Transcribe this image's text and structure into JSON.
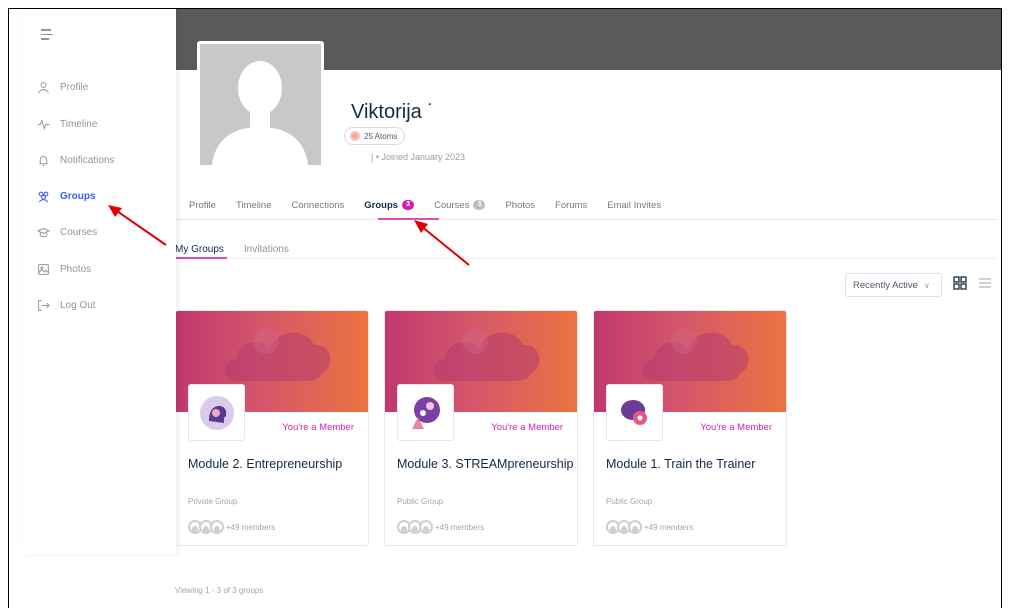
{
  "sidebar": {
    "items": [
      {
        "label": "Profile",
        "icon": "user-icon",
        "active": false
      },
      {
        "label": "Timeline",
        "icon": "activity-icon",
        "active": false
      },
      {
        "label": "Notifications",
        "icon": "bell-icon",
        "active": false
      },
      {
        "label": "Groups",
        "icon": "groups-icon",
        "active": true
      },
      {
        "label": "Courses",
        "icon": "graduation-cap-icon",
        "active": false
      },
      {
        "label": "Photos",
        "icon": "image-icon",
        "active": false
      },
      {
        "label": "Log Out",
        "icon": "logout-icon",
        "active": false
      }
    ]
  },
  "profile": {
    "name": "Viktorija ˙",
    "atoms": "25 Atoms",
    "joined": "| • Joined January 2023"
  },
  "tabs": [
    {
      "label": "Profile"
    },
    {
      "label": "Timeline"
    },
    {
      "label": "Connections"
    },
    {
      "label": "Groups",
      "badge": "3",
      "active": true
    },
    {
      "label": "Courses",
      "badge": "3"
    },
    {
      "label": "Photos"
    },
    {
      "label": "Forums"
    },
    {
      "label": "Email Invites"
    }
  ],
  "subtabs": [
    {
      "label": "My Groups",
      "active": true
    },
    {
      "label": "Invitations"
    }
  ],
  "sort": {
    "selected": "Recently Active"
  },
  "groups": [
    {
      "title": "Module 2. Entrepreneurship",
      "type": "Private Group",
      "status": "You're a Member",
      "members": "+49 members"
    },
    {
      "title": "Module 3. STREAMpreneurship",
      "type": "Public Group",
      "status": "You're a Member",
      "members": "+49 members"
    },
    {
      "title": "Module 1. Train the Trainer",
      "type": "Public Group",
      "status": "You're a Member",
      "members": "+49 members"
    }
  ],
  "footer": {
    "viewing": "Viewing 1 - 3 of 3 groups"
  },
  "colors": {
    "accent": "#385dff",
    "badge": "#d21fb6",
    "underline": "#e04ab9",
    "cover": "#5a5a5a",
    "arrow": "#e00000"
  }
}
